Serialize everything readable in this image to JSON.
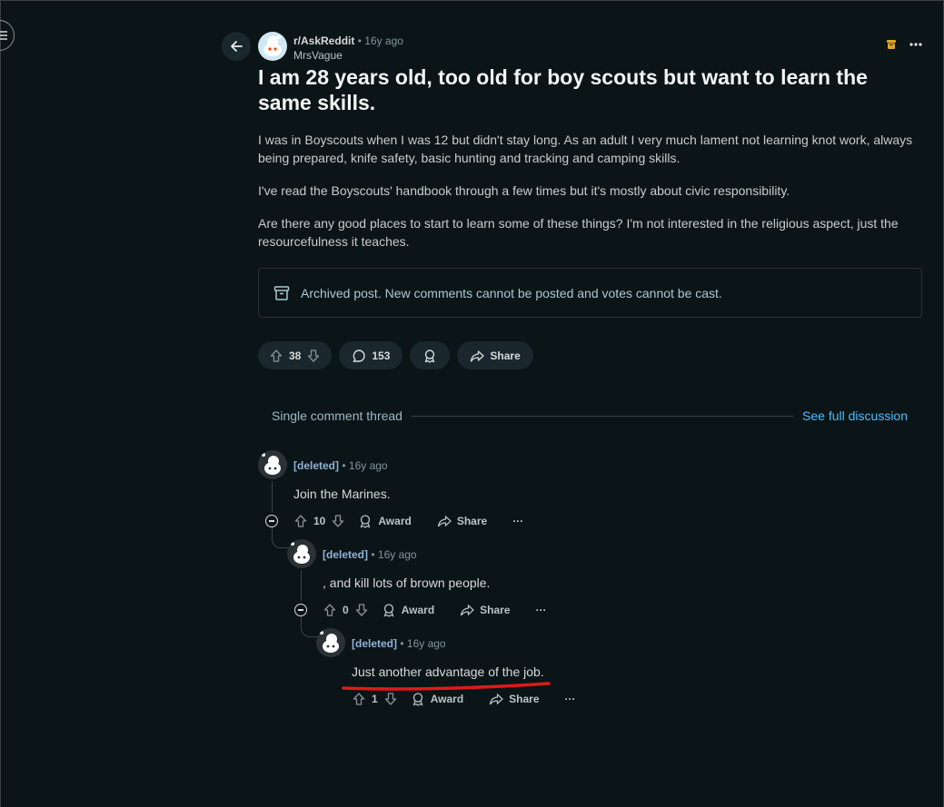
{
  "nav": {
    "menu_icon": "hamburger-icon",
    "back_icon": "arrow-left-icon"
  },
  "post": {
    "subreddit": "r/AskReddit",
    "separator": "•",
    "time": "16y ago",
    "author": "MrsVague",
    "title": "I am 28 years old, too old for boy scouts but want to learn the same skills.",
    "paragraphs": [
      "I was in Boyscouts when I was 12 but didn't stay long. As an adult I very much lament not learning knot work, always being prepared, knife safety, basic hunting and tracking and camping skills.",
      "I've read the Boyscouts' handbook through a few times but it's mostly about civic responsibility.",
      "Are there any good places to start to learn some of these things? I'm not interested in the religious aspect, just the resourcefulness it teaches."
    ],
    "archived_notice": "Archived post. New comments cannot be posted and votes cannot be cast.",
    "votes": "38",
    "comments": "153",
    "share_label": "Share"
  },
  "thread": {
    "label": "Single comment thread",
    "see_full": "See full discussion"
  },
  "comments": [
    {
      "author": "[deleted]",
      "separator": "•",
      "time": "16y ago",
      "text": "Join the Marines.",
      "votes": "10",
      "award": "Award",
      "share": "Share",
      "more": "···"
    },
    {
      "author": "[deleted]",
      "separator": "•",
      "time": "16y ago",
      "text": ", and kill lots of brown people.",
      "votes": "0",
      "award": "Award",
      "share": "Share",
      "more": "···"
    },
    {
      "author": "[deleted]",
      "separator": "•",
      "time": "16y ago",
      "text": "Just another advantage of the job.",
      "votes": "1",
      "award": "Award",
      "share": "Share",
      "more": "···"
    }
  ],
  "colors": {
    "background": "#0b1416",
    "link": "#4fbcff",
    "archive_icon": "#e0a526",
    "annotation": "#e0191b"
  }
}
